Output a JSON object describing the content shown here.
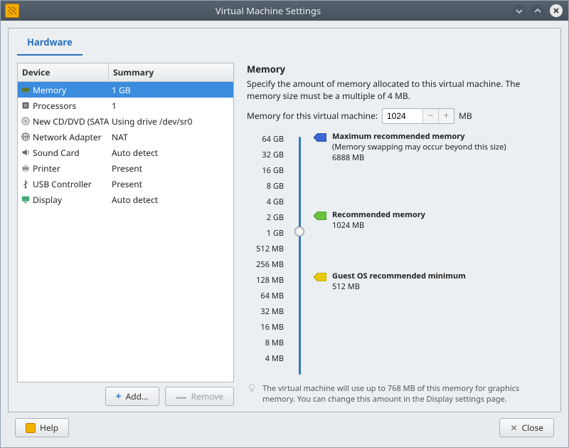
{
  "window": {
    "title": "Virtual Machine Settings"
  },
  "tab": {
    "hardware": "Hardware"
  },
  "table": {
    "col1": "Device",
    "col2": "Summary",
    "rows": [
      {
        "name": "Memory",
        "summary": "1 GB"
      },
      {
        "name": "Processors",
        "summary": "1"
      },
      {
        "name": "New CD/DVD (SATA)",
        "summary": "Using drive /dev/sr0"
      },
      {
        "name": "Network Adapter",
        "summary": "NAT"
      },
      {
        "name": "Sound Card",
        "summary": "Auto detect"
      },
      {
        "name": "Printer",
        "summary": "Present"
      },
      {
        "name": "USB Controller",
        "summary": "Present"
      },
      {
        "name": "Display",
        "summary": "Auto detect"
      }
    ]
  },
  "buttons": {
    "add": "Add...",
    "remove": "Remove",
    "help": "Help",
    "close": "Close"
  },
  "memory": {
    "heading": "Memory",
    "desc": "Specify the amount of memory allocated to this virtual machine. The memory size must be a multiple of 4 MB.",
    "fieldlabel": "Memory for this virtual machine:",
    "value": "1024",
    "unit": "MB",
    "ticks": [
      "64 GB",
      "32 GB",
      "16 GB",
      "8 GB",
      "4 GB",
      "2 GB",
      "1 GB",
      "512 MB",
      "256 MB",
      "128 MB",
      "64 MB",
      "32 MB",
      "16 MB",
      "8 MB",
      "4 MB"
    ],
    "max": {
      "title": "Maximum recommended memory",
      "sub": "(Memory swapping may occur beyond this size)",
      "val": "6888 MB"
    },
    "rec": {
      "title": "Recommended memory",
      "val": "1024 MB"
    },
    "min": {
      "title": "Guest OS recommended minimum",
      "val": "512 MB"
    },
    "note": "The virtual machine will use up to 768 MB of this memory for graphics memory. You can change this amount in the Display settings page."
  },
  "colors": {
    "max": "#3a67d4",
    "rec": "#6ac23b",
    "min": "#e8c800"
  }
}
